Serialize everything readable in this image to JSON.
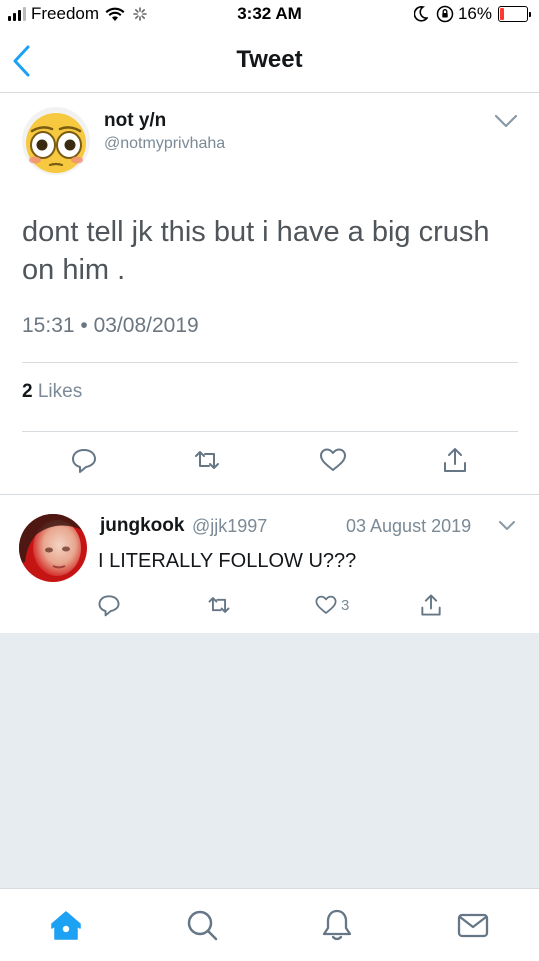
{
  "status_bar": {
    "carrier": "Freedom",
    "time": "3:32 AM",
    "battery_percent": "16%",
    "battery_level": 0.16,
    "battery_color": "#ff3b30"
  },
  "nav": {
    "title": "Tweet",
    "back_icon": "chevron-left-icon",
    "accent_color": "#1da1f2"
  },
  "tweet": {
    "display_name": "not y/n",
    "handle": "@notmyprivhaha",
    "avatar": "flushed-face-emoji",
    "text": "dont tell jk this but i have a big crush on him .",
    "timestamp": "15:31 • 03/08/2019",
    "like_count": "2",
    "likes_label": "Likes",
    "actions": [
      "reply-icon",
      "retweet-icon",
      "like-icon",
      "share-icon"
    ]
  },
  "reply": {
    "display_name": "jungkook",
    "handle": "@jjk1997",
    "date": "03 August 2019",
    "text": "I LITERALLY FOLLOW U???",
    "like_count": "3",
    "actions": [
      "reply-icon",
      "retweet-icon",
      "like-icon",
      "share-icon"
    ]
  },
  "tab_bar": {
    "tabs": [
      "home-icon",
      "search-icon",
      "notifications-icon",
      "messages-icon"
    ],
    "active_tab": "home-icon"
  }
}
